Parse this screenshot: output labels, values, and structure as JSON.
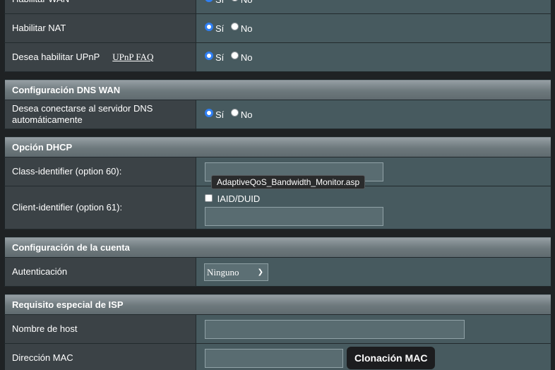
{
  "colors": {
    "section_header": "#6d787c",
    "label_bg": "#3b4246",
    "value_bg": "#475a5f",
    "radio_selected": "#2f7ff3"
  },
  "radio_options": {
    "yes": "Sí",
    "no": "No"
  },
  "wan_section": {
    "rows": [
      {
        "label": "Habilitar WAN",
        "selected": "yes"
      },
      {
        "label": "Habilitar NAT",
        "selected": "yes"
      },
      {
        "label": "Desea habilitar UPnP",
        "link": "UPnP FAQ",
        "selected": "yes"
      }
    ]
  },
  "dns_section": {
    "title": "Configuración DNS WAN",
    "auto_dns": {
      "label": "Desea conectarse al servidor DNS automáticamente",
      "selected": "yes"
    }
  },
  "dhcp_section": {
    "title": "Opción DHCP",
    "class_id": {
      "label": "Class-identifier (option 60):",
      "value": ""
    },
    "client_id": {
      "label": "Client-identifier (option 61):",
      "checkbox_label": "IAID/DUID",
      "checked": false,
      "value": ""
    }
  },
  "account_section": {
    "title": "Configuración de la cuenta",
    "auth": {
      "label": "Autenticación",
      "selected": "Ninguno"
    }
  },
  "isp_section": {
    "title": "Requisito especial de ISP",
    "hostname": {
      "label": "Nombre de host",
      "value": ""
    },
    "mac": {
      "label": "Dirección MAC",
      "value": "",
      "clone_button": "Clonación MAC"
    }
  },
  "tooltip": {
    "text": "AdaptiveQoS_Bandwidth_Monitor.asp"
  }
}
